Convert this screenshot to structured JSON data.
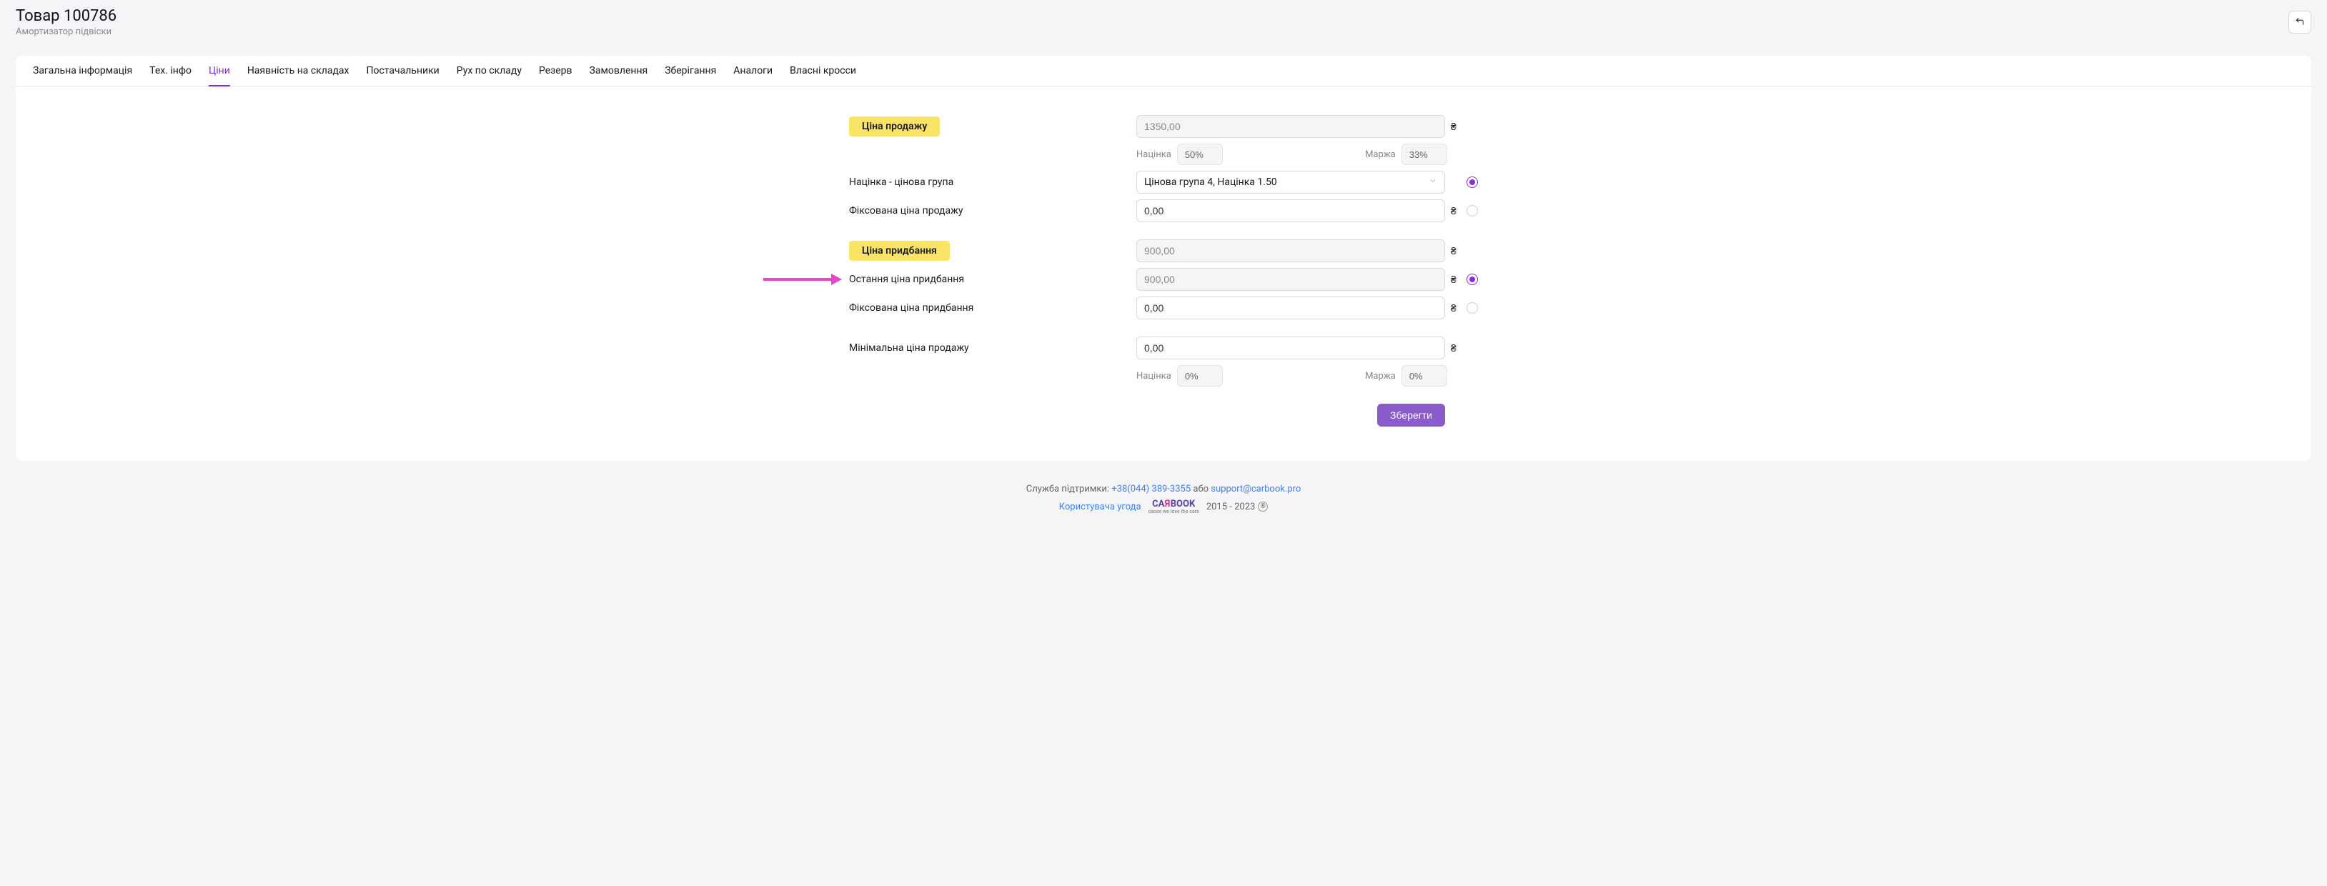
{
  "header": {
    "title": "Товар 100786",
    "subtitle": "Амортизатор підвіски"
  },
  "tabs": [
    {
      "label": "Загальна інформація"
    },
    {
      "label": "Тех. інфо"
    },
    {
      "label": "Ціни",
      "active": true
    },
    {
      "label": "Наявність на складах"
    },
    {
      "label": "Постачальники"
    },
    {
      "label": "Рух по складу"
    },
    {
      "label": "Резерв"
    },
    {
      "label": "Замовлення"
    },
    {
      "label": "Зберігання"
    },
    {
      "label": "Аналоги"
    },
    {
      "label": "Власні кросси"
    }
  ],
  "currency": "₴",
  "form": {
    "sale_price_label": "Ціна продажу",
    "sale_price": "1350,00",
    "markup_label": "Націнка",
    "markup_value": "50%",
    "margin_label": "Маржа",
    "margin_value": "33%",
    "markup_group_label": "Націнка - цінова група",
    "markup_group_value": "Цінова група 4, Націнка 1.50",
    "fixed_sale_label": "Фіксована ціна продажу",
    "fixed_sale_value": "0,00",
    "purchase_price_label": "Ціна придбання",
    "purchase_price": "900,00",
    "last_purchase_label": "Остання ціна придбання",
    "last_purchase_value": "900,00",
    "fixed_purchase_label": "Фіксована ціна придбання",
    "fixed_purchase_value": "0,00",
    "min_sale_label": "Мінімальна ціна продажу",
    "min_sale_value": "0,00",
    "min_markup_value": "0%",
    "min_margin_value": "0%",
    "save_button": "Зберегти"
  },
  "footer": {
    "support_prefix": "Служба підтримки: ",
    "phone": "+38(044) 389-3355",
    "or": " або ",
    "email": "support@carbook.pro",
    "agreement": "Користувача угода",
    "logo": {
      "ca": "CA",
      "r": "R",
      "book": "BOOK",
      "sub": "cause we love the cars"
    },
    "years": " 2015 - 2023 ",
    "reg": "®"
  }
}
